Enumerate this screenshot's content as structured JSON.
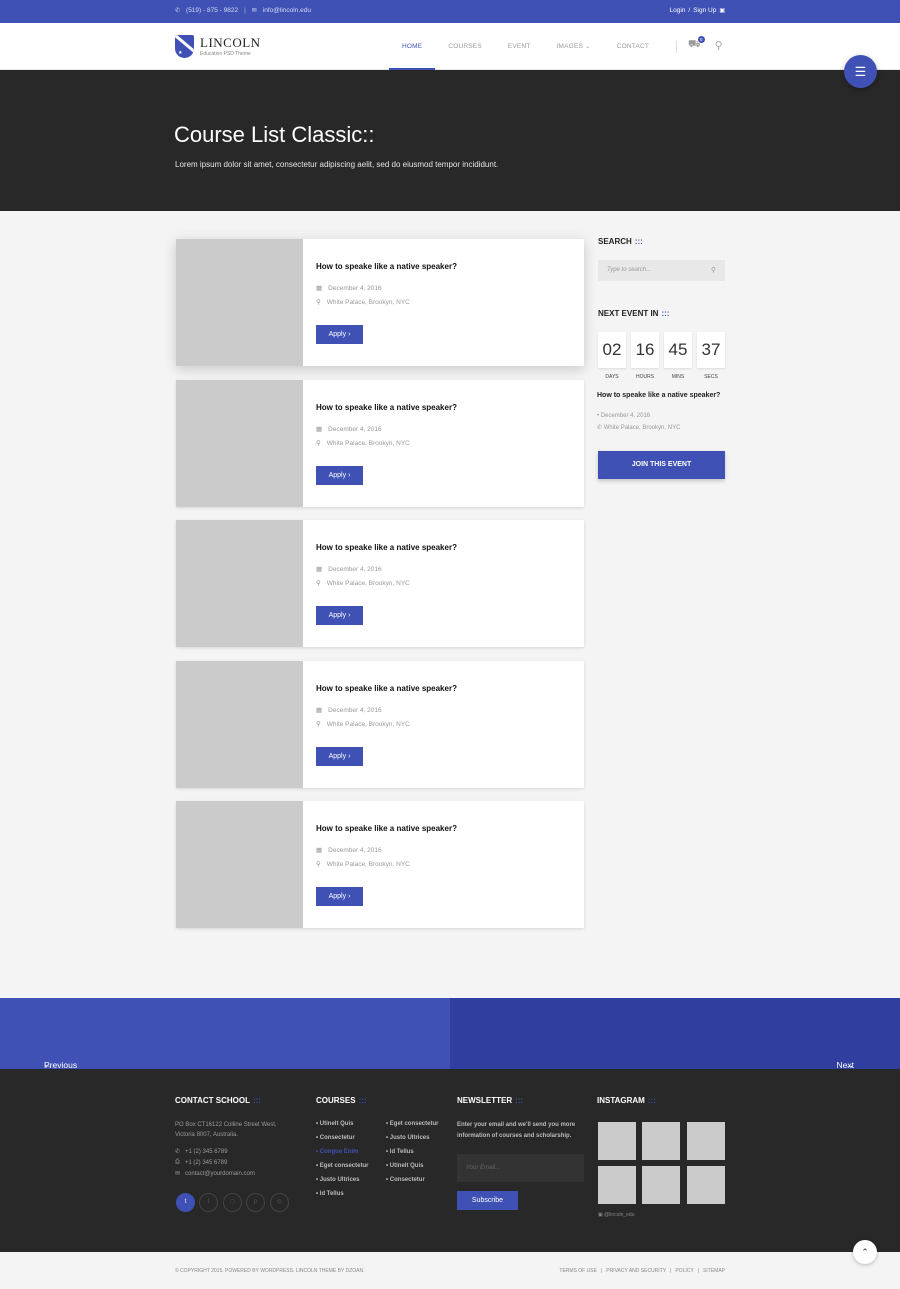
{
  "topbar": {
    "phone": "(519) - 875 - 9822",
    "email": "info@lincoln.edu",
    "login": "Login",
    "signup": "Sign Up"
  },
  "brand": {
    "name": "LINCOLN",
    "tagline": "Education PSD Theme"
  },
  "nav": {
    "items": [
      "HOME",
      "COURSES",
      "EVENT",
      "IMAGES",
      "CONTACT"
    ],
    "cart_count": "0"
  },
  "hero": {
    "title": "Course List Classic::",
    "subtitle": "Lorem ipsum dolor sit amet, consectetur adipiscing aelit, sed do eiusmod tempor incididunt."
  },
  "courses": [
    {
      "title": "How to speake like a native speaker?",
      "date": "December 4, 2016",
      "location": "White Palace, Brookyn, NYC",
      "button": "Apply"
    },
    {
      "title": "How to speake like a native speaker?",
      "date": "December 4, 2016",
      "location": "White Palace, Brookyn, NYC",
      "button": "Apply"
    },
    {
      "title": "How to speake like a native speaker?",
      "date": "December 4, 2016",
      "location": "White Palace, Brookyn, NYC",
      "button": "Apply"
    },
    {
      "title": "How to speake like a native speaker?",
      "date": "December 4, 2016",
      "location": "White Palace, Brookyn, NYC",
      "button": "Apply"
    },
    {
      "title": "How to speake like a native speaker?",
      "date": "December 4, 2016",
      "location": "White Palace, Brookyn, NYC",
      "button": "Apply"
    }
  ],
  "sidebar": {
    "search_title": "SEARCH",
    "search_placeholder": "Type to search...",
    "event_heading": "NEXT EVENT IN",
    "countdown": [
      {
        "value": "02",
        "label": "DAYS"
      },
      {
        "value": "16",
        "label": "HOURS"
      },
      {
        "value": "45",
        "label": "MINS"
      },
      {
        "value": "37",
        "label": "SECS"
      }
    ],
    "event_title": "How to speake like a native speaker?",
    "event_date": "December 4, 2016",
    "event_location": "White Palace, Brookyn, NYC",
    "join_label": "JOIN THIS EVENT"
  },
  "pager": {
    "prev": "Previous",
    "next": "Next"
  },
  "footer": {
    "contact_title": "CONTACT SCHOOL",
    "address": "PO Box CT16122 Colline Street West, Victoria 8007, Australia.",
    "phone": "+1 (2) 345 6789",
    "fax": "+1 (2) 345 6789",
    "email": "contact@yourdomain.com",
    "courses_title": "COURSES",
    "courses_col1": [
      "Utinelt Quis",
      "Consectetur",
      "Congue Enim",
      "Eget consectetur",
      "Justo Ultrices",
      "Id Tellus"
    ],
    "courses_col2": [
      "Eget consectetur",
      "Justo Ultrices",
      "Id Tellus",
      "Utinelt Quis",
      "Consectetur"
    ],
    "newsletter_title": "NEWSLETTER",
    "newsletter_text": "Enter your email and we'll send you more information of courses and scholarship.",
    "email_placeholder": "Your Email...",
    "subscribe": "Subscribe",
    "instagram_title": "INSTAGRAM",
    "instagram_handle": "@lincoln_edu"
  },
  "bottom": {
    "copyright": "© COPYRIGHT 2015. POWERED BY WORDPRESS. LINCOLN THEME BY DZOAN.",
    "links": [
      "TERMS OF USE",
      "PRIVACY AND SECURITY",
      "POLICY",
      "SITEMAP"
    ]
  },
  "colors": {
    "accent": "#3f51b5",
    "accent_dark": "#303f9f",
    "dark": "#282828"
  },
  "icons": {
    "menu": "menu-icon",
    "search": "search-icon",
    "cart": "cart-icon",
    "arrow_up": "arrow-up-icon"
  }
}
